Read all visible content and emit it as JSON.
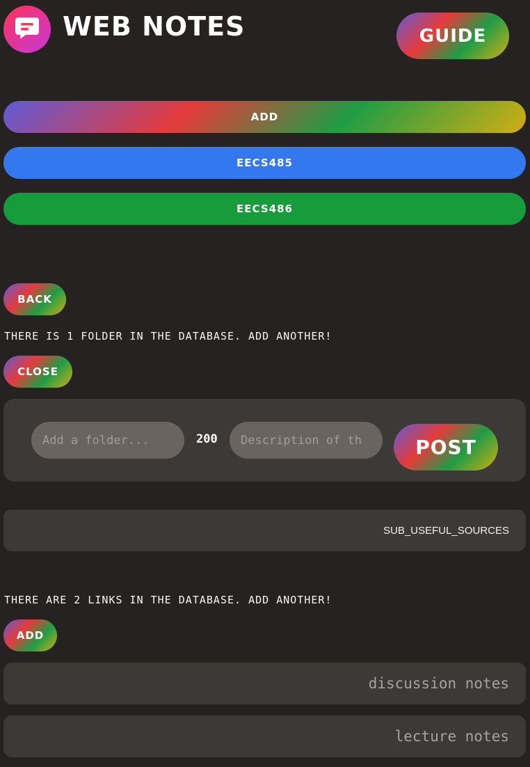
{
  "header": {
    "app_title": "WEB NOTES",
    "logo_icon": "chat-bubble-icon",
    "guide_label": "GUIDE"
  },
  "classes": {
    "add_label": "ADD",
    "items": [
      {
        "label": "EECS485",
        "color": "#3478f0"
      },
      {
        "label": "EECS486",
        "color": "#169c3a"
      }
    ]
  },
  "folders": {
    "back_label": "BACK",
    "count_text": "THERE IS 1 FOLDER IN THE DATABASE. ADD ANOTHER!",
    "close_label": "CLOSE",
    "form": {
      "folder_placeholder": "Add a folder...",
      "char_count": "200",
      "description_placeholder": "Description of th",
      "post_label": "POST"
    },
    "items": [
      {
        "label": "SUB_USEFUL_SOURCES"
      }
    ]
  },
  "links": {
    "count_text": "THERE ARE 2 LINKS IN THE DATABASE. ADD ANOTHER!",
    "add_label": "ADD",
    "items": [
      {
        "label": "discussion notes"
      },
      {
        "label": "lecture notes"
      }
    ]
  },
  "colors": {
    "background": "#262222",
    "panel": "#3d3936",
    "gradient": [
      "#5f5bd6",
      "#e53b3b",
      "#1f9d45",
      "#d2ad14"
    ]
  }
}
